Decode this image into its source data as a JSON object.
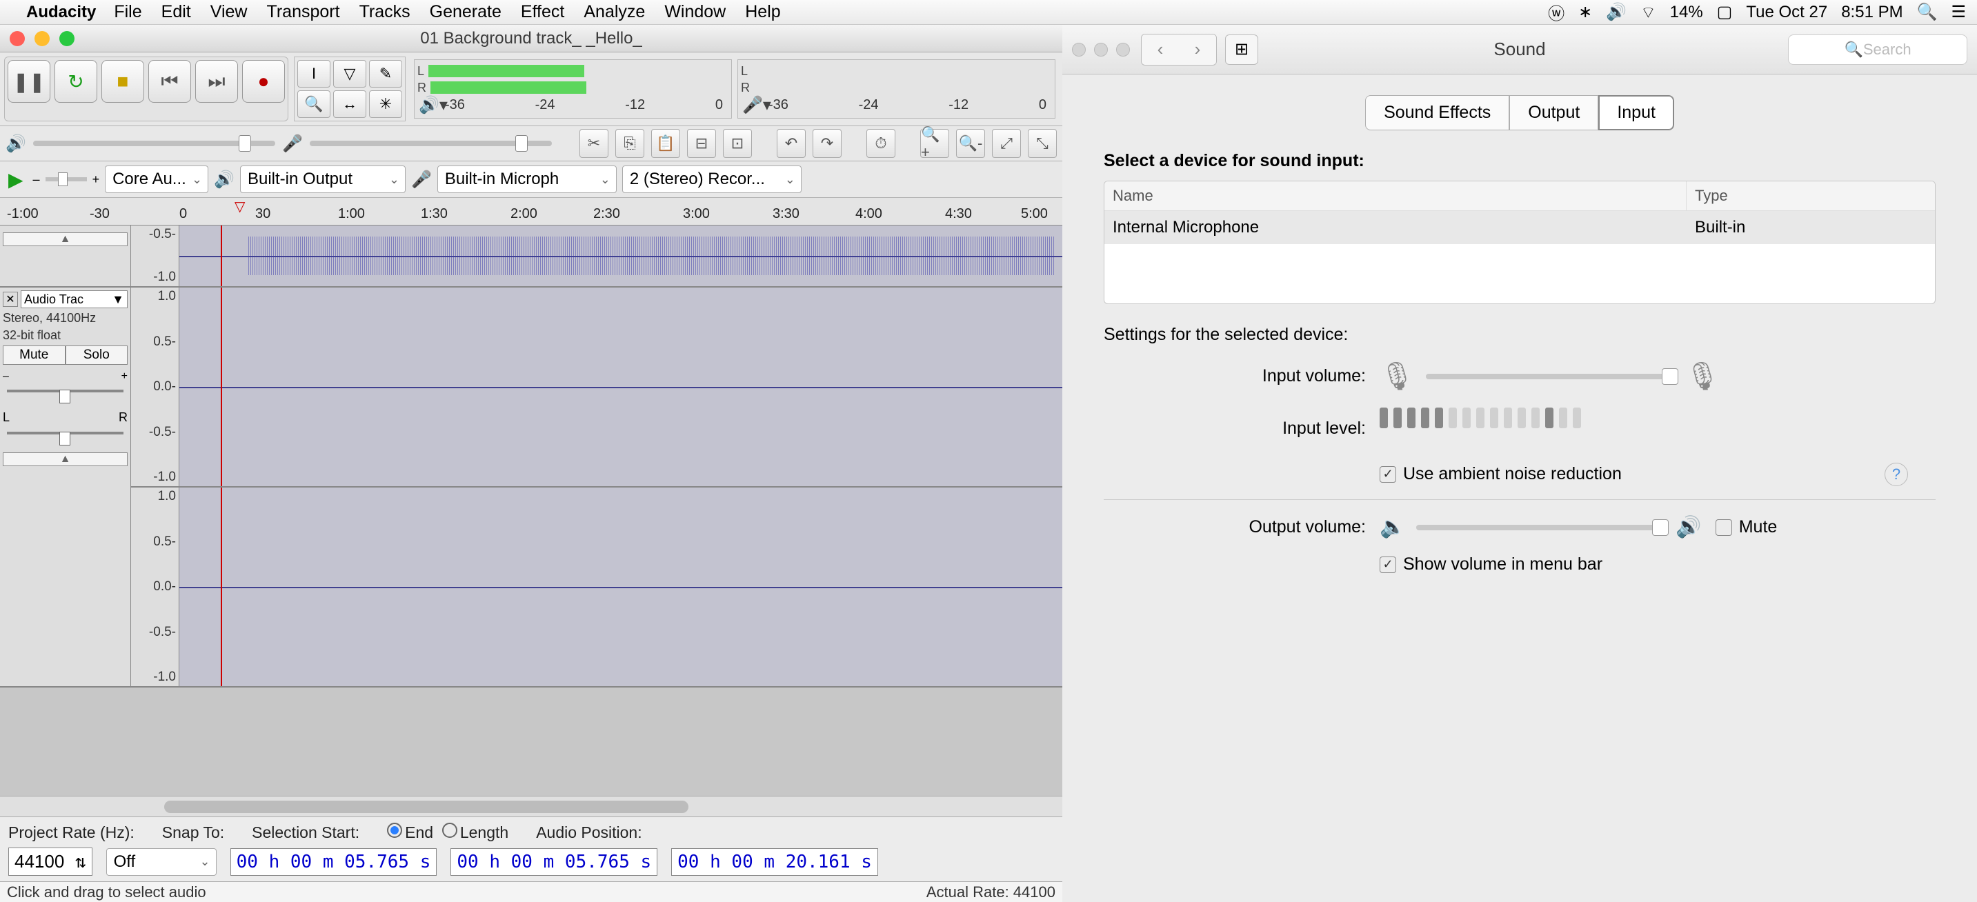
{
  "menubar": {
    "app": "Audacity",
    "items": [
      "File",
      "Edit",
      "View",
      "Transport",
      "Tracks",
      "Generate",
      "Effect",
      "Analyze",
      "Window",
      "Help"
    ],
    "battery": "14%",
    "date": "Tue Oct 27",
    "time": "8:51 PM"
  },
  "audacity": {
    "title": "01 Background track_ _Hello_",
    "meter_scale": [
      "-36",
      "-24",
      "-12",
      "0"
    ],
    "meter_lr": [
      "L",
      "R"
    ],
    "devices": {
      "host": "Core Au...",
      "output": "Built-in Output",
      "input": "Built-in Microph",
      "channels": "2 (Stereo) Recor..."
    },
    "ruler": [
      "-1:00",
      "-30",
      "0",
      "30",
      "1:00",
      "1:30",
      "2:00",
      "2:30",
      "3:00",
      "3:30",
      "4:00",
      "4:30",
      "5:00"
    ],
    "track1": {
      "scale": [
        "-0.5-",
        "-1.0"
      ]
    },
    "track2": {
      "name": "Audio Trac",
      "meta1": "Stereo, 44100Hz",
      "meta2": "32-bit float",
      "mute": "Mute",
      "solo": "Solo",
      "scale": [
        "1.0",
        "0.5-",
        "0.0-",
        "-0.5-",
        "-1.0"
      ],
      "pan_l": "L",
      "pan_r": "R"
    },
    "bottom": {
      "proj_label": "Project Rate (Hz):",
      "proj_val": "44100",
      "snap_label": "Snap To:",
      "snap_val": "Off",
      "sel_label": "Selection Start:",
      "end": "End",
      "length": "Length",
      "sel_start": "00 h 00 m 05.765 s",
      "sel_end": "00 h 00 m 05.765 s",
      "pos_label": "Audio Position:",
      "pos_val": "00 h 00 m 20.161 s"
    },
    "status_left": "Click and drag to select audio",
    "status_right": "Actual Rate: 44100"
  },
  "sound": {
    "title": "Sound",
    "search_ph": "Search",
    "tabs": [
      "Sound Effects",
      "Output",
      "Input"
    ],
    "active_tab": 2,
    "heading": "Select a device for sound input:",
    "col_name": "Name",
    "col_type": "Type",
    "dev_name": "Internal Microphone",
    "dev_type": "Built-in",
    "settings_heading": "Settings for the selected device:",
    "input_vol": "Input volume:",
    "input_lvl": "Input level:",
    "noise": "Use ambient noise reduction",
    "output_vol": "Output volume:",
    "mute": "Mute",
    "show_vol": "Show volume in menu bar"
  }
}
